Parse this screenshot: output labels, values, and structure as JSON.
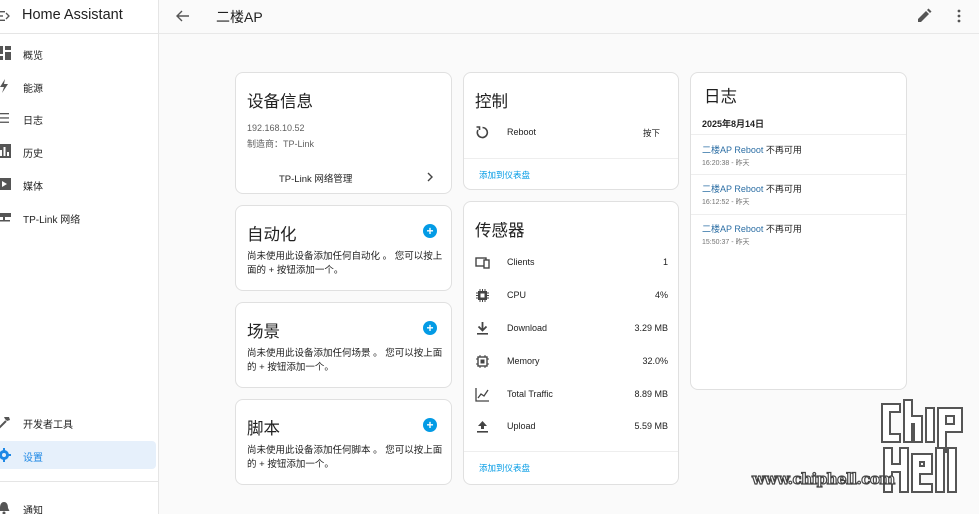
{
  "app": {
    "title": "Home Assistant"
  },
  "sidebar": {
    "items": [
      {
        "label": "概览",
        "icon": "dashboard-icon"
      },
      {
        "label": "能源",
        "icon": "lightning-icon"
      },
      {
        "label": "日志",
        "icon": "list-icon"
      },
      {
        "label": "历史",
        "icon": "chart-icon"
      },
      {
        "label": "媒体",
        "icon": "play-icon"
      },
      {
        "label": "TP-Link 网络",
        "icon": "network-icon"
      }
    ],
    "bottom_items": [
      {
        "label": "开发者工具",
        "icon": "hammer-icon"
      },
      {
        "label": "设置",
        "icon": "gear-icon",
        "active": true
      },
      {
        "label": "通知",
        "icon": "bell-icon"
      }
    ]
  },
  "header": {
    "title": "二楼AP"
  },
  "device_info": {
    "title": "设备信息",
    "ip": "192.168.10.52",
    "manufacturer": "制造商：TP-Link",
    "link_label": "TP-Link 网络管理"
  },
  "automation": {
    "title": "自动化",
    "desc": "尚未使用此设备添加任何自动化 。 您可以按上面的 + 按钮添加一个。"
  },
  "scene": {
    "title": "场景",
    "desc": "尚未使用此设备添加任何场景 。 您可以按上面的 + 按钮添加一个。"
  },
  "script_card": {
    "title": "脚本",
    "desc": "尚未使用此设备添加任何脚本 。 您可以按上面的 + 按钮添加一个。"
  },
  "control": {
    "title": "控制",
    "items": [
      {
        "name": "Reboot",
        "action": "按下",
        "icon": "restart-icon"
      }
    ],
    "add_label": "添加到仪表盘"
  },
  "sensors": {
    "title": "传感器",
    "items": [
      {
        "name": "Clients",
        "value": "1",
        "icon": "devices-icon"
      },
      {
        "name": "CPU",
        "value": "4%",
        "icon": "cpu-icon"
      },
      {
        "name": "Download",
        "value": "3.29 MB",
        "icon": "download-icon"
      },
      {
        "name": "Memory",
        "value": "32.0%",
        "icon": "memory-icon"
      },
      {
        "name": "Total Traffic",
        "value": "8.89 MB",
        "icon": "traffic-chart-icon"
      },
      {
        "name": "Upload",
        "value": "5.59 MB",
        "icon": "upload-icon"
      }
    ],
    "add_label": "添加到仪表盘"
  },
  "logbook": {
    "title": "日志",
    "date": "2025年8月14日",
    "entries": [
      {
        "entity": "二楼AP Reboot",
        "text": " 不再可用",
        "time": "16:20:38 - 昨天"
      },
      {
        "entity": "二楼AP Reboot",
        "text": " 不再可用",
        "time": "16:12:52 - 昨天"
      },
      {
        "entity": "二楼AP Reboot",
        "text": " 不再可用",
        "time": "15:50:37 - 昨天"
      }
    ]
  },
  "watermark": {
    "text": "www.chiphell.com",
    "logo_text": "chip hell"
  }
}
